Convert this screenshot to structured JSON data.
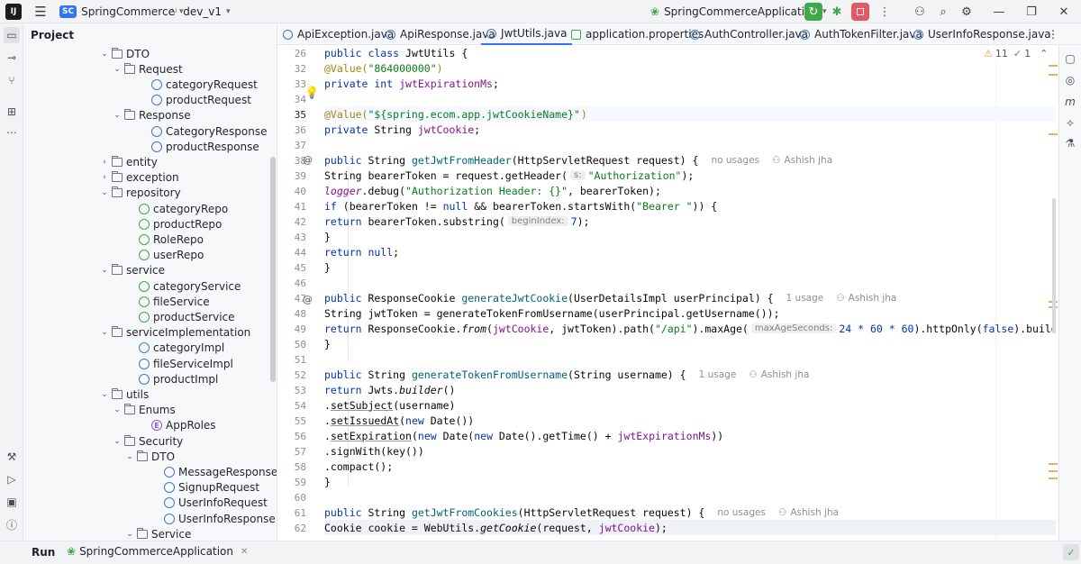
{
  "titlebar": {
    "project_badge": "SC",
    "project_name": "SpringCommerce",
    "branch": "dev_v1",
    "run_config": "SpringCommerceApplication"
  },
  "project_panel": {
    "title": "Project"
  },
  "tree": [
    {
      "label": "DTO",
      "kind": "folder",
      "depth": 3,
      "open": true
    },
    {
      "label": "Request",
      "kind": "folder",
      "depth": 4,
      "open": true
    },
    {
      "label": "categoryRequest",
      "kind": "class",
      "depth": 5
    },
    {
      "label": "productRequest",
      "kind": "class",
      "depth": 5
    },
    {
      "label": "Response",
      "kind": "folder",
      "depth": 4,
      "open": true
    },
    {
      "label": "CategoryResponse",
      "kind": "class",
      "depth": 5
    },
    {
      "label": "productResponse",
      "kind": "class",
      "depth": 5
    },
    {
      "label": "entity",
      "kind": "folder",
      "depth": 3,
      "open": false
    },
    {
      "label": "exception",
      "kind": "folder",
      "depth": 3,
      "open": false
    },
    {
      "label": "repository",
      "kind": "folder",
      "depth": 3,
      "open": true
    },
    {
      "label": "categoryRepo",
      "kind": "interface",
      "depth": 4
    },
    {
      "label": "productRepo",
      "kind": "interface",
      "depth": 4
    },
    {
      "label": "RoleRepo",
      "kind": "interface",
      "depth": 4
    },
    {
      "label": "userRepo",
      "kind": "interface",
      "depth": 4
    },
    {
      "label": "service",
      "kind": "folder",
      "depth": 3,
      "open": true
    },
    {
      "label": "categoryService",
      "kind": "interface",
      "depth": 4
    },
    {
      "label": "fileService",
      "kind": "interface",
      "depth": 4
    },
    {
      "label": "productService",
      "kind": "interface",
      "depth": 4
    },
    {
      "label": "serviceImplementation",
      "kind": "folder",
      "depth": 3,
      "open": true
    },
    {
      "label": "categoryImpl",
      "kind": "class",
      "depth": 4
    },
    {
      "label": "fileServiceImpl",
      "kind": "class",
      "depth": 4
    },
    {
      "label": "productImpl",
      "kind": "class",
      "depth": 4
    },
    {
      "label": "utils",
      "kind": "folder",
      "depth": 3,
      "open": true
    },
    {
      "label": "Enums",
      "kind": "folder",
      "depth": 4,
      "open": true
    },
    {
      "label": "AppRoles",
      "kind": "enum",
      "depth": 5
    },
    {
      "label": "Security",
      "kind": "folder",
      "depth": 4,
      "open": true
    },
    {
      "label": "DTO",
      "kind": "folder",
      "depth": 5,
      "open": true
    },
    {
      "label": "MessageResponse",
      "kind": "class",
      "depth": 6
    },
    {
      "label": "SignupRequest",
      "kind": "class",
      "depth": 6
    },
    {
      "label": "UserInfoRequest",
      "kind": "class",
      "depth": 6
    },
    {
      "label": "UserInfoResponse",
      "kind": "class",
      "depth": 6
    },
    {
      "label": "Service",
      "kind": "folder",
      "depth": 5,
      "open": true
    }
  ],
  "tabs": [
    {
      "label": "ApiException.java",
      "active": false
    },
    {
      "label": "ApiResponse.java",
      "active": false
    },
    {
      "label": "JwtUtils.java",
      "active": true
    },
    {
      "label": "application.properties",
      "active": false
    },
    {
      "label": "AuthController.java",
      "active": false
    },
    {
      "label": "AuthTokenFilter.java",
      "active": false
    },
    {
      "label": "UserInfoResponse.java",
      "active": false
    }
  ],
  "inspections": {
    "warnings": "11",
    "weak": "1"
  },
  "line_numbers": [
    "26",
    "32",
    "33",
    "34",
    "35",
    "36",
    "37",
    "38",
    "39",
    "40",
    "41",
    "42",
    "43",
    "44",
    "45",
    "46",
    "47",
    "48",
    "49",
    "50",
    "51",
    "52",
    "53",
    "54",
    "55",
    "56",
    "57",
    "58",
    "59",
    "60",
    "61",
    "62"
  ],
  "code": {
    "l26": [
      "public class JwtUtils {"
    ],
    "l32_a": "@Value(",
    "l32_b": "\"864000000\"",
    "l32_c": ")",
    "l33_kw": "private int ",
    "l33_f": "jwtExpirationMs",
    "l33_e": ";",
    "l35_a": "@Value(",
    "l35_b": "\"${spring.ecom.app.jwtCookieName}\"",
    "l35_c": ")",
    "l36_kw": "private ",
    "l36_t": "String ",
    "l36_f": "jwtCookie",
    "l36_e": ";",
    "l38_kw": "public ",
    "l38_t": "String ",
    "l38_fn": "getJwtFromHeader",
    "l38_rest": "(HttpServletRequest request) {",
    "l38_meta1": "no usages",
    "l38_meta2": "Ashish jha",
    "l39_a": "String bearerToken = request.getHeader(",
    "l39_hint": "s:",
    "l39_s": "\"Authorization\"",
    "l39_e": ");",
    "l40_a": "logger",
    "l40_b": ".debug(",
    "l40_s": "\"Authorization Header: {}\"",
    "l40_e": ", bearerToken);",
    "l41_kw": "if ",
    "l41_a": "(bearerToken != ",
    "l41_kw2": "null",
    "l41_b": " && bearerToken.startsWith(",
    "l41_s": "\"Bearer \"",
    "l41_e": ")) {",
    "l42_kw": "return ",
    "l42_a": "bearerToken.substring(",
    "l42_hint": "beginIndex:",
    "l42_n": "7",
    "l42_e": ");",
    "l43": "}",
    "l44_kw": "return ",
    "l44_kw2": "null",
    "l44_e": ";",
    "l45": "}",
    "l47_kw": "public ",
    "l47_t": "ResponseCookie ",
    "l47_fn": "generateJwtCookie",
    "l47_rest": "(UserDetailsImpl userPrincipal) {",
    "l47_meta1": "1 usage",
    "l47_meta2": "Ashish jha",
    "l48": "String jwtToken = generateTokenFromUsername(userPrincipal.getUsername());",
    "l49_kw": "return ",
    "l49_a": "ResponseCookie.",
    "l49_from": "from",
    "l49_b": "(",
    "l49_f": "jwtCookie",
    "l49_c": ", jwtToken).path(",
    "l49_s": "\"/api\"",
    "l49_d": ").maxAge(",
    "l49_hint": "maxAgeSeconds:",
    "l49_n": "24 * 60 * 60",
    "l49_e": ").httpOnly(",
    "l49_kw2": "false",
    "l49_f2": ").build();",
    "l50": "}",
    "l52_kw": "public ",
    "l52_t": "String ",
    "l52_fn": "generateTokenFromUsername",
    "l52_rest": "(String username) {",
    "l52_meta1": "1 usage",
    "l52_meta2": "Ashish jha",
    "l53_kw": "return ",
    "l53_a": "Jwts.",
    "l53_b": "builder",
    "l53_c": "()",
    "l54_a": ".",
    "l54_b": "setSubject",
    "l54_c": "(username)",
    "l55_b": "setIssuedAt",
    "l55_c": "(",
    "l55_kw": "new ",
    "l55_d": "Date())",
    "l56_b": "setExpiration",
    "l56_c": "(",
    "l56_kw": "new ",
    "l56_d": "Date(",
    "l56_kw2": "new ",
    "l56_e": "Date().getTime() + ",
    "l56_f": "jwtExpirationMs",
    "l56_g": "))",
    "l57": ".signWith(key())",
    "l58": ".compact();",
    "l59": "}",
    "l61_kw": "public ",
    "l61_t": "String ",
    "l61_fn": "getJwtFromCookies",
    "l61_rest": "(HttpServletRequest request) {",
    "l61_meta1": "no usages",
    "l61_meta2": "Ashish jha",
    "l62_a": "Cookie cookie = WebUtils.",
    "l62_b": "getCookie",
    "l62_c": "(request, ",
    "l62_f": "jwtCookie",
    "l62_e": ");"
  },
  "bottom": {
    "run_label": "Run",
    "run_tab": "SpringCommerceApplication"
  }
}
